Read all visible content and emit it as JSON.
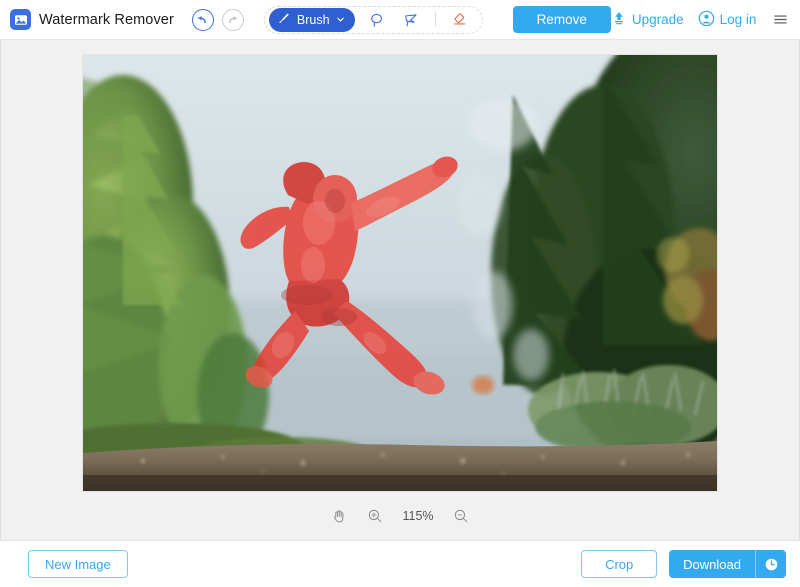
{
  "app": {
    "title": "Watermark Remover",
    "logo_icon": "photo-logo-icon"
  },
  "topbar": {
    "undo_icon": "undo-arrow-icon",
    "redo_icon": "redo-arrow-icon",
    "tools": {
      "brush_label": "Brush",
      "brush_icon": "brush-icon",
      "brush_chevron_icon": "chevron-down-icon",
      "lasso_icon": "lasso-icon",
      "polygon_lasso_icon": "polygon-lasso-icon",
      "eraser_icon": "eraser-icon"
    },
    "remove_label": "Remove",
    "upgrade_label": "Upgrade",
    "upgrade_icon": "upload-arrow-icon",
    "login_label": "Log in",
    "login_icon": "user-circle-icon",
    "menu_icon": "hamburger-menu-icon",
    "close_icon": "close-icon"
  },
  "canvas": {
    "image_alt": "lakeside forest photo with person jumping, red selection mask",
    "mask_color": "#e8382e",
    "zoom": {
      "pan_icon": "hand-pan-icon",
      "zoom_in_icon": "zoom-in-icon",
      "zoom_out_icon": "zoom-out-icon",
      "level": "115%"
    }
  },
  "bottombar": {
    "new_image_label": "New Image",
    "crop_label": "Crop",
    "download_label": "Download",
    "download_extra_icon": "clock-icon"
  },
  "colors": {
    "brand_blue": "#3b6fe0",
    "brush_blue": "#2f5fd0",
    "accent_blue": "#33a9ef",
    "outline_blue": "#7ec8f2",
    "eraser_orange": "#e2713c",
    "canvas_bg": "#f1f1f1"
  }
}
